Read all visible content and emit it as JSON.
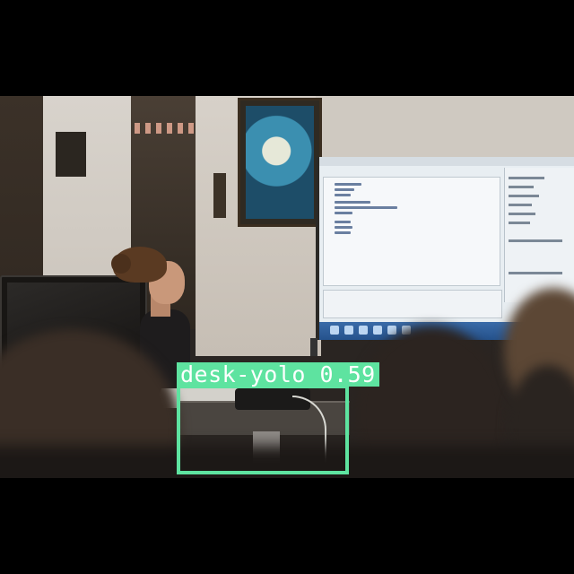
{
  "detection": {
    "label": "desk-yolo 0.59",
    "class_name": "desk-yolo",
    "confidence": 0.59,
    "box_color": "#5ee3a0",
    "label_text_color": "#ffffff"
  },
  "background_color": "#000000"
}
